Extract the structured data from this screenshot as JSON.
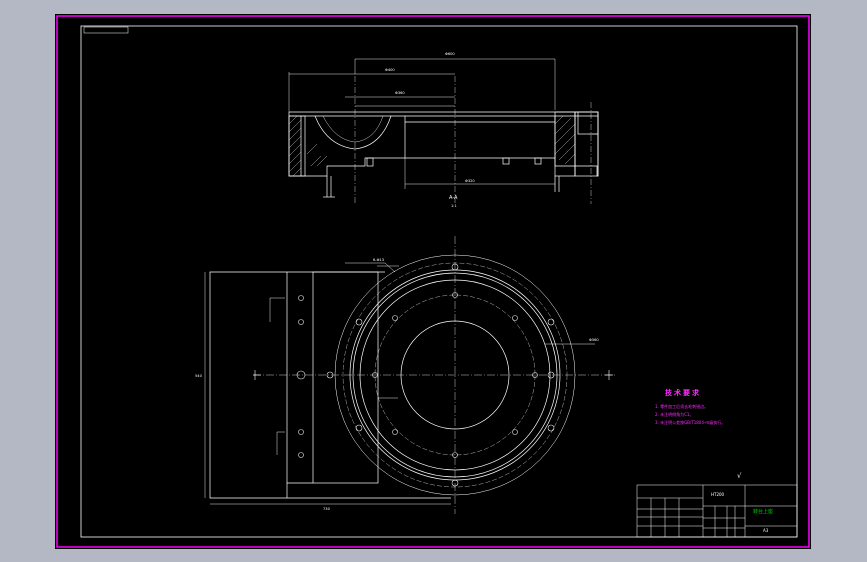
{
  "section_label": "A-A",
  "scale_label": "1:1",
  "tech_requirements": {
    "title": "技术要求",
    "notes": [
      "1. 零件加工后须去毛刺锐边。",
      "2. 未注明倒角为C1。",
      "3. 未注明公差按GB/T1804-m级执行。"
    ]
  },
  "roughness_mark": "√",
  "title_block": {
    "material": "HT200",
    "part_name": "转台上座",
    "sheet": "A3"
  },
  "dims": {
    "top_overall": "Φ600",
    "top_mid": "Φ400",
    "top_inner": "Φ360",
    "bottom": "Φ320",
    "plan_width": "730",
    "plan_height": "540",
    "hole_note": "6-Φ13",
    "bolt_circle": "Φ560"
  },
  "colors": {
    "background": "#000000",
    "frame": "#ff00ff",
    "lines": "#ffffff",
    "notes": "#ff2cff",
    "title_block_text": "#00d000"
  }
}
